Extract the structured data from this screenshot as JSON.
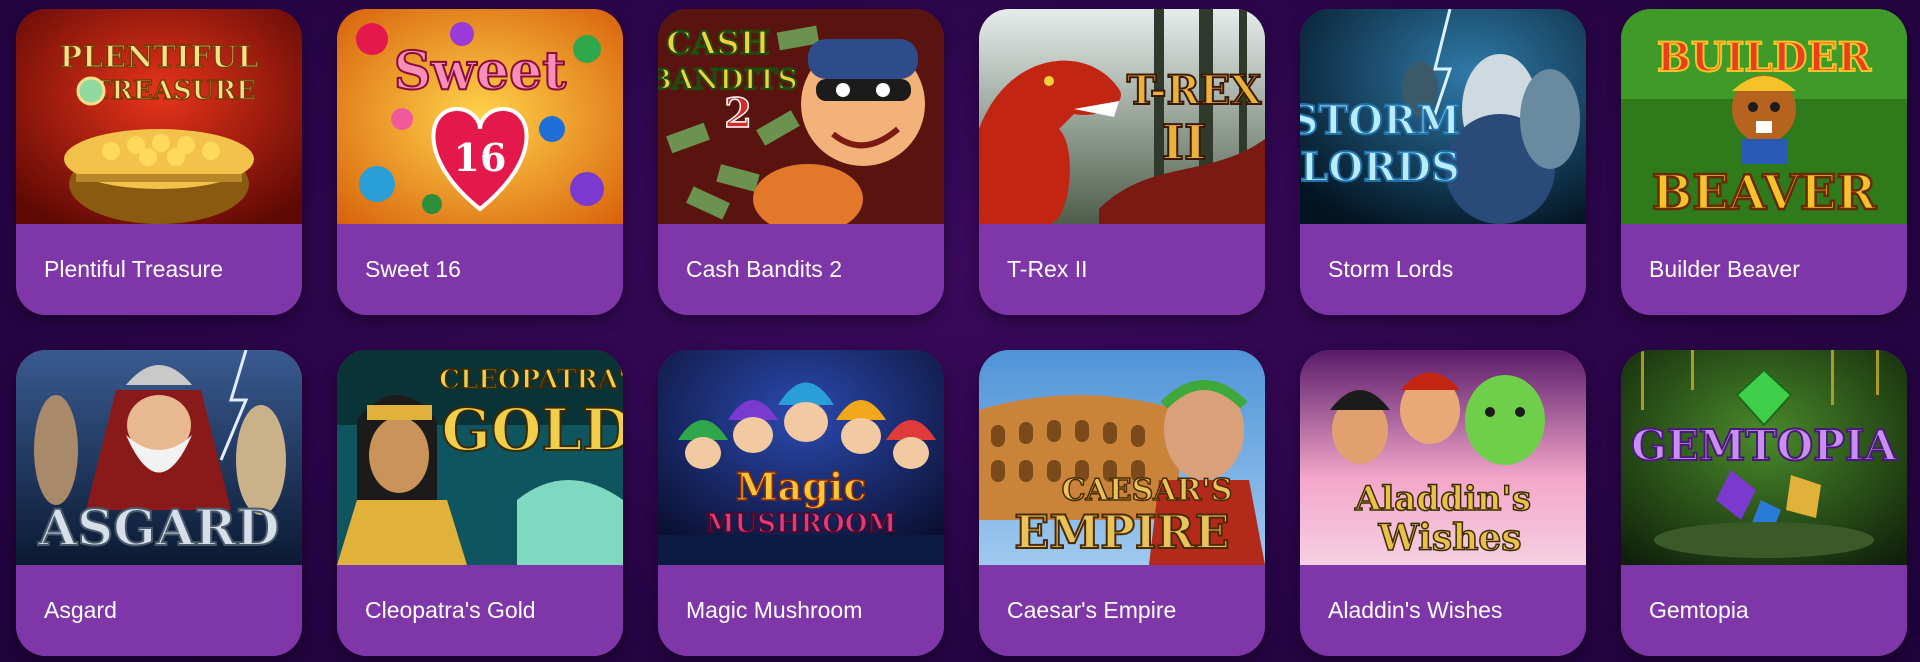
{
  "games": [
    {
      "id": "plentiful-treasure",
      "label": "Plentiful Treasure",
      "logo": [
        "PLENTIFUL",
        "TREASURE"
      ],
      "colors": {
        "bg1": "#c21d0c",
        "bg2": "#6d0a05",
        "accent": "#f3c24a",
        "logo": "#f7e08a"
      }
    },
    {
      "id": "sweet-16",
      "label": "Sweet 16",
      "logo": [
        "Sweet",
        "16"
      ],
      "colors": {
        "bg1": "#f7a21a",
        "bg2": "#c9560a",
        "accent": "#e5184b",
        "logo": "#f58fb7"
      }
    },
    {
      "id": "cash-bandits-2",
      "label": "Cash Bandits 2",
      "logo": [
        "CASH",
        "BANDITS",
        "2"
      ],
      "colors": {
        "bg1": "#7a1a12",
        "bg2": "#3a0c08",
        "accent": "#e3a23a",
        "logo": "#f2d23a"
      }
    },
    {
      "id": "t-rex-ii",
      "label": "T-Rex II",
      "logo": [
        "T-REX",
        "II"
      ],
      "colors": {
        "bg1": "#bfc8c9",
        "bg2": "#3f4a3e",
        "accent": "#c22512",
        "logo": "#e9b23a"
      }
    },
    {
      "id": "storm-lords",
      "label": "Storm Lords",
      "logo": [
        "STORM",
        "LORDS"
      ],
      "colors": {
        "bg1": "#0d3c5e",
        "bg2": "#041a2c",
        "accent": "#9fd7ff",
        "logo": "#b9ecff"
      }
    },
    {
      "id": "builder-beaver",
      "label": "Builder Beaver",
      "logo": [
        "BUILDER",
        "BEAVER"
      ],
      "colors": {
        "bg1": "#3d8a22",
        "bg2": "#1f4a10",
        "accent": "#b5631e",
        "logo": "#f6c22a"
      }
    },
    {
      "id": "asgard",
      "label": "Asgard",
      "logo": [
        "ASGARD"
      ],
      "colors": {
        "bg1": "#223d6a",
        "bg2": "#0b1a33",
        "accent": "#8a1a1a",
        "logo": "#d7e0ea"
      }
    },
    {
      "id": "cleopatras-gold",
      "label": "Cleopatra's Gold",
      "logo": [
        "CLEOPATRA'S",
        "GOLD"
      ],
      "colors": {
        "bg1": "#12656e",
        "bg2": "#0a3338",
        "accent": "#e0b23a",
        "logo": "#f2cf4a"
      }
    },
    {
      "id": "magic-mushroom",
      "label": "Magic Mushroom",
      "logo": [
        "Magic",
        "MUSHROOM"
      ],
      "colors": {
        "bg1": "#1b2a6e",
        "bg2": "#0a0f30",
        "accent": "#e03a7a",
        "logo": "#f6c63a"
      }
    },
    {
      "id": "caesars-empire",
      "label": "Caesar's Empire",
      "logo": [
        "CAESAR'S",
        "EMPIRE"
      ],
      "colors": {
        "bg1": "#5f9fd8",
        "bg2": "#c9843a",
        "accent": "#b36b2a",
        "logo": "#e9c25a"
      }
    },
    {
      "id": "aladdins-wishes",
      "label": "Aladdin's Wishes",
      "logo": [
        "Aladdin's",
        "Wishes"
      ],
      "colors": {
        "bg1": "#f3a7c9",
        "bg2": "#9b3a8f",
        "accent": "#5fbf3a",
        "logo": "#e9c04a"
      }
    },
    {
      "id": "gemtopia",
      "label": "Gemtopia",
      "logo": [
        "GEMTOPIA"
      ],
      "colors": {
        "bg1": "#2f5a1e",
        "bg2": "#142a0c",
        "accent": "#7a3ad0",
        "logo": "#c98ff0"
      }
    }
  ]
}
